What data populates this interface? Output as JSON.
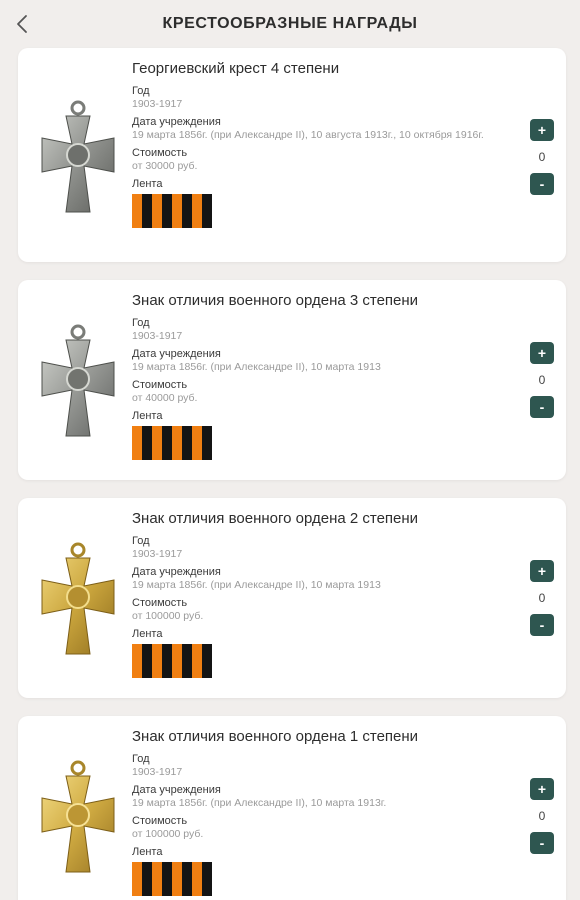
{
  "header": {
    "title": "КРЕСТООБРАЗНЫЕ НАГРАДЫ"
  },
  "labels": {
    "year": "Год",
    "established": "Дата учреждения",
    "cost": "Стоимость",
    "ribbon": "Лента"
  },
  "items": [
    {
      "name": "Георгиевский крест 4 степени",
      "year": "1903-1917",
      "established": "19 марта 1856г. (при Александре II), 10 августа 1913г., 10 октября 1916г.",
      "cost": "от 30000 руб.",
      "count": "0",
      "metal": "silver"
    },
    {
      "name": "Знак отличия военного ордена 3 степени",
      "year": "1903-1917",
      "established": "19 марта 1856г. (при Александре II), 10 марта 1913",
      "cost": "от 40000 руб.",
      "count": "0",
      "metal": "silver"
    },
    {
      "name": "Знак отличия военного ордена 2 степени",
      "year": "1903-1917",
      "established": "19 марта 1856г. (при Александре II), 10 марта 1913",
      "cost": "от 100000 руб.",
      "count": "0",
      "metal": "gold"
    },
    {
      "name": "Знак отличия военного ордена 1 степени",
      "year": "1903-1917",
      "established": "19 марта 1856г. (при Александре II), 10 марта 1913г.",
      "cost": "от 100000 руб.",
      "count": "0",
      "metal": "gold"
    }
  ],
  "buttons": {
    "plus": "+",
    "minus": "-"
  },
  "colors": {
    "ribbon_orange": "#f07f12",
    "ribbon_black": "#141414",
    "button": "#2e5650",
    "silver": "#9a9c98",
    "gold": "#c9a43c"
  }
}
